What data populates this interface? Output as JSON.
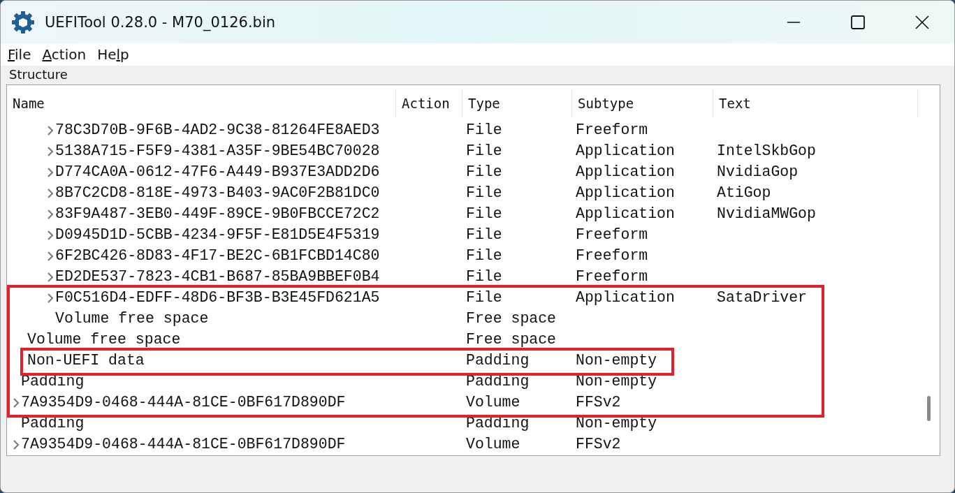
{
  "window": {
    "title": "UEFITool 0.28.0 - M70_0126.bin"
  },
  "menu": [
    {
      "label": "File"
    },
    {
      "label": "Action"
    },
    {
      "label": "Help"
    }
  ],
  "structure": {
    "title": "Structure",
    "columns": [
      "Name",
      "Action",
      "Type",
      "Subtype",
      "Text"
    ],
    "rows": [
      {
        "children": [
          {
            "children": [
              {
                "expandable": true,
                "name": "78C3D70B-9F6B-4AD2-9C38-81264FE8AED3",
                "type": "File",
                "subtype": "Freeform"
              },
              {
                "expandable": true,
                "name": "5138A715-F5F9-4381-A35F-9BE54BC70028",
                "type": "File",
                "subtype": "Application",
                "text": "IntelSkbGop"
              },
              {
                "expandable": true,
                "name": "D774CA0A-0612-47F6-A449-B937E3ADD2D6",
                "type": "File",
                "subtype": "Application",
                "text": "NvidiaGop"
              },
              {
                "expandable": true,
                "name": "8B7C2CD8-818E-4973-B403-9AC0F2B81DC0",
                "type": "File",
                "subtype": "Application",
                "text": "AtiGop"
              },
              {
                "expandable": true,
                "name": "83F9A487-3EB0-449F-89CE-9B0FBCCE72C2",
                "type": "File",
                "subtype": "Application",
                "text": "NvidiaMWGop"
              },
              {
                "expandable": true,
                "name": "D0945D1D-5CBB-4234-9F5F-E81D5E4F5319",
                "type": "File",
                "subtype": "Freeform"
              },
              {
                "expandable": true,
                "name": "6F2BC426-8D83-4F17-BE2C-6B1FCBD14C80",
                "type": "File",
                "subtype": "Freeform"
              },
              {
                "expandable": true,
                "name": "ED2DE537-7823-4CB1-B687-85BA9BBEF0B4",
                "type": "File",
                "subtype": "Freeform"
              },
              {
                "expandable": true,
                "name": "F0C516D4-EDFF-48D6-BF3B-B3E45FD621A5",
                "type": "File",
                "subtype": "Application",
                "text": "SataDriver"
              },
              {
                "expandable": false,
                "name": "Volume free space",
                "type": "Free space"
              }
            ]
          },
          {
            "expandable": false,
            "name": "Volume free space",
            "type": "Free space"
          },
          {
            "expandable": false,
            "name": "Non-UEFI data",
            "type": "Padding",
            "subtype": "Non-empty"
          }
        ]
      },
      {
        "expandable": false,
        "name": "Padding",
        "type": "Padding",
        "subtype": "Non-empty"
      },
      {
        "expandable": true,
        "name": "7A9354D9-0468-444A-81CE-0BF617D890DF",
        "type": "Volume",
        "subtype": "FFSv2"
      },
      {
        "expandable": false,
        "name": "Padding",
        "type": "Padding",
        "subtype": "Non-empty"
      },
      {
        "expandable": true,
        "name": "7A9354D9-0468-444A-81CE-0BF617D890DF",
        "type": "Volume",
        "subtype": "FFSv2"
      }
    ]
  }
}
